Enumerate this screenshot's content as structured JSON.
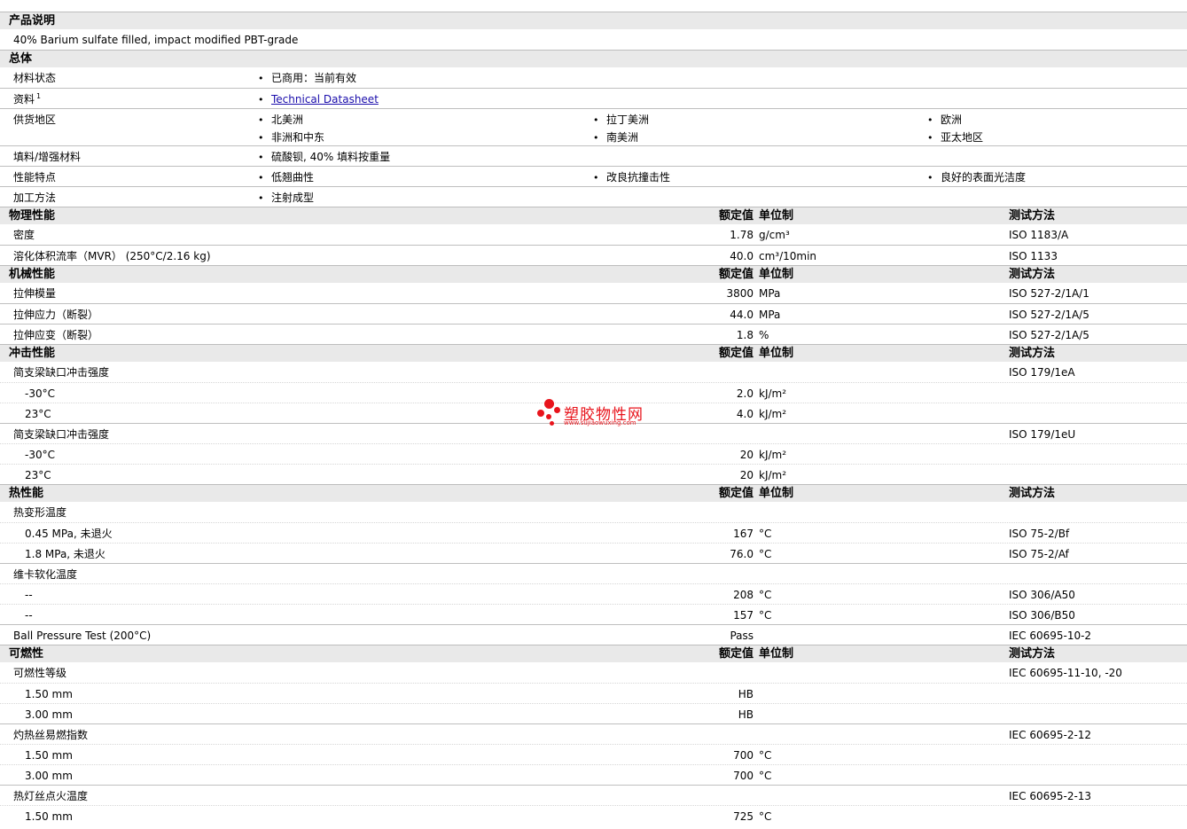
{
  "product_desc": {
    "header": "产品说明",
    "text": "40% Barium sulfate filled, impact modified PBT-grade"
  },
  "general": {
    "header": "总体",
    "material_status": {
      "label": "材料状态",
      "value": "已商用：当前有效"
    },
    "resources": {
      "label": "资料",
      "sup": "1",
      "link": "Technical Datasheet"
    },
    "supply": {
      "label": "供货地区",
      "regions": [
        "北美洲",
        "拉丁美洲",
        "欧洲",
        "非洲和中东",
        "南美洲",
        "亚太地区"
      ]
    },
    "filler": {
      "label": "填料/增强材料",
      "value": "硫酸钡, 40% 填料按重量"
    },
    "features": {
      "label": "性能特点",
      "items": [
        "低翘曲性",
        "改良抗撞击性",
        "良好的表面光洁度"
      ]
    },
    "processing": {
      "label": "加工方法",
      "value": "注射成型"
    }
  },
  "col_headers": {
    "nominal": "额定值",
    "unit": "单位制",
    "test": "测试方法"
  },
  "physical": {
    "header": "物理性能",
    "rows": [
      {
        "name": "密度",
        "value": "1.78",
        "unit": "g/cm³",
        "test": "ISO 1183/A"
      },
      {
        "name": "溶化体积流率（MVR） (250°C/2.16 kg)",
        "value": "40.0",
        "unit": "cm³/10min",
        "test": "ISO 1133"
      }
    ]
  },
  "mechanical": {
    "header": "机械性能",
    "rows": [
      {
        "name": "拉伸模量",
        "value": "3800",
        "unit": "MPa",
        "test": "ISO 527-2/1A/1"
      },
      {
        "name": "拉伸应力（断裂）",
        "value": "44.0",
        "unit": "MPa",
        "test": "ISO 527-2/1A/5"
      },
      {
        "name": "拉伸应变（断裂）",
        "value": "1.8",
        "unit": "%",
        "test": "ISO 527-2/1A/5"
      }
    ]
  },
  "impact": {
    "header": "冲击性能",
    "notched": {
      "name": "简支梁缺口冲击强度",
      "test": "ISO 179/1eA",
      "rows": [
        {
          "cond": "-30°C",
          "value": "2.0",
          "unit": "kJ/m²"
        },
        {
          "cond": "23°C",
          "value": "4.0",
          "unit": "kJ/m²"
        }
      ]
    },
    "unnotched": {
      "name": "简支梁缺口冲击强度",
      "test": "ISO 179/1eU",
      "rows": [
        {
          "cond": "-30°C",
          "value": "20",
          "unit": "kJ/m²"
        },
        {
          "cond": "23°C",
          "value": "20",
          "unit": "kJ/m²"
        }
      ]
    }
  },
  "thermal": {
    "header": "热性能",
    "hdt": {
      "name": "热变形温度",
      "rows": [
        {
          "cond": "0.45 MPa, 未退火",
          "value": "167",
          "unit": "°C",
          "test": "ISO 75-2/Bf"
        },
        {
          "cond": "1.8 MPa, 未退火",
          "value": "76.0",
          "unit": "°C",
          "test": "ISO 75-2/Af"
        }
      ]
    },
    "vicat": {
      "name": "维卡软化温度",
      "rows": [
        {
          "cond": "--",
          "value": "208",
          "unit": "°C",
          "test": "ISO 306/A50"
        },
        {
          "cond": "--",
          "value": "157",
          "unit": "°C",
          "test": "ISO 306/B50"
        }
      ]
    },
    "ball": {
      "name": "Ball Pressure Test (200°C)",
      "value": "Pass",
      "test": "IEC 60695-10-2"
    }
  },
  "flammability": {
    "header": "可燃性",
    "rating": {
      "name": "可燃性等级",
      "test": "IEC 60695-11-10, -20",
      "rows": [
        {
          "cond": "1.50 mm",
          "value": "HB"
        },
        {
          "cond": "3.00 mm",
          "value": "HB"
        }
      ]
    },
    "gwfi": {
      "name": "灼热丝易燃指数",
      "test": "IEC 60695-2-12",
      "rows": [
        {
          "cond": "1.50 mm",
          "value": "700",
          "unit": "°C"
        },
        {
          "cond": "3.00 mm",
          "value": "700",
          "unit": "°C"
        }
      ]
    },
    "gwit": {
      "name": "热灯丝点火温度",
      "test": "IEC 60695-2-13",
      "rows": [
        {
          "cond": "1.50 mm",
          "value": "725",
          "unit": "°C"
        }
      ]
    }
  },
  "watermark": {
    "title": "塑胶物性网",
    "url": "www.sujiaowuxing.com",
    "color": "#e8141c"
  }
}
